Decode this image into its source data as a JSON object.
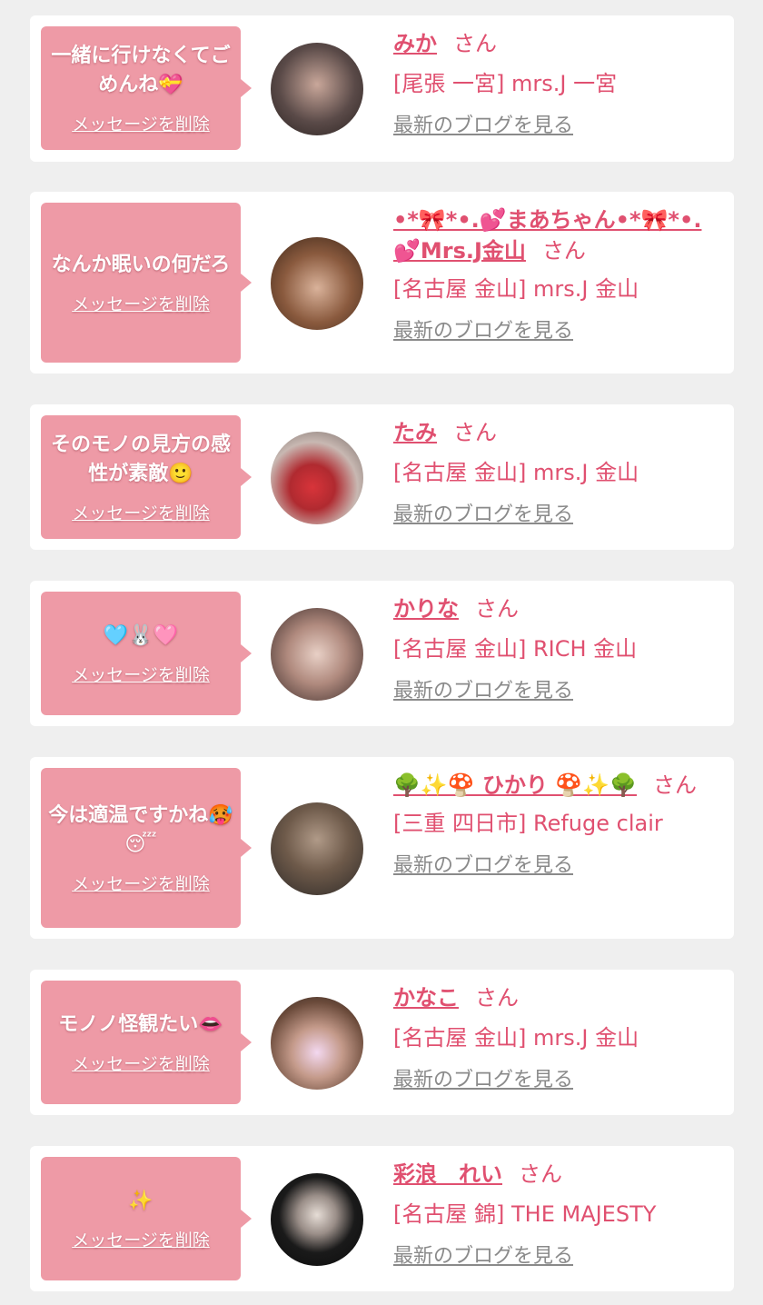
{
  "colors": {
    "accent": "#e05070",
    "bubble": "#ee9aa6",
    "background": "#efefef",
    "link_gray": "#8a8a8a"
  },
  "cards": [
    {
      "message": "一緒に行けなくてごめんね💝",
      "delete_label": "メッセージを削除",
      "name": "みか",
      "honorific": "さん",
      "shop": "[尾張 一宮] mrs.J 一宮",
      "blog_label": "最新のブログを見る"
    },
    {
      "message": "なんか眠いの何だろ",
      "delete_label": "メッセージを削除",
      "name": "•*🎀*•.💕まあちゃん•*🎀*•.💕Mrs.J金山",
      "honorific": "さん",
      "shop": "[名古屋 金山] mrs.J 金山",
      "blog_label": "最新のブログを見る"
    },
    {
      "message": "そのモノの見方の感性が素敵🙂",
      "delete_label": "メッセージを削除",
      "name": "たみ",
      "honorific": "さん",
      "shop": "[名古屋 金山] mrs.J 金山",
      "blog_label": "最新のブログを見る"
    },
    {
      "message": "🩵🐰🩷",
      "delete_label": "メッセージを削除",
      "name": "かりな",
      "honorific": "さん",
      "shop": "[名古屋 金山] RICH 金山",
      "blog_label": "最新のブログを見る"
    },
    {
      "message": "今は適温ですかね🥵😴",
      "delete_label": "メッセージを削除",
      "name": "🌳✨🍄 ひかり 🍄✨🌳",
      "honorific": "さん",
      "shop": "[三重 四日市] Refuge clair",
      "blog_label": "最新のブログを見る"
    },
    {
      "message": "モノノ怪観たい👄",
      "delete_label": "メッセージを削除",
      "name": "かなこ",
      "honorific": "さん",
      "shop": "[名古屋 金山] mrs.J 金山",
      "blog_label": "最新のブログを見る"
    },
    {
      "message": "✨",
      "delete_label": "メッセージを削除",
      "name": "彩浪　れい",
      "honorific": "さん",
      "shop": "[名古屋 錦] THE MAJESTY",
      "blog_label": "最新のブログを見る"
    }
  ]
}
